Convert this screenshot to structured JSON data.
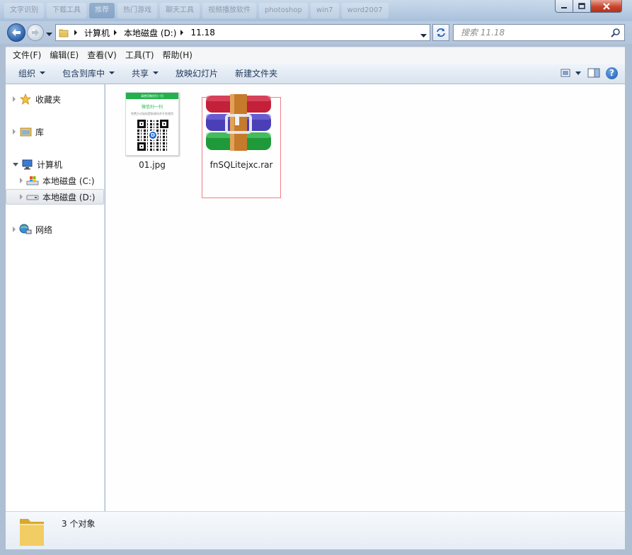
{
  "titlebar": {
    "ghost_tabs": [
      "文字识别",
      "下载工具",
      "推荐",
      "热门游戏",
      "聊天工具",
      "视频播放软件",
      "photoshop",
      "win7",
      "word2007"
    ]
  },
  "address": {
    "breadcrumbs": [
      "计算机",
      "本地磁盘 (D:)",
      "11.18"
    ]
  },
  "search": {
    "placeholder": "搜索 11.18"
  },
  "menu": {
    "items": [
      "文件(F)",
      "编辑(E)",
      "查看(V)",
      "工具(T)",
      "帮助(H)"
    ]
  },
  "toolbar": {
    "organize": "组织",
    "include_in_library": "包含到库中",
    "share": "共享",
    "slideshow": "放映幻灯片",
    "new_folder": "新建文件夹"
  },
  "nav": {
    "favorites": "收藏夹",
    "libraries": "库",
    "computer": "计算机",
    "drive_c": "本地磁盘 (C:)",
    "drive_d": "本地磁盘 (D:)",
    "network": "网络"
  },
  "files": [
    {
      "name": "01.jpg",
      "icon": "jpg-thumbnail",
      "thumb_header": "请使用微信扫一扫",
      "thumb_title": "微信扫一扫",
      "thumb_sub": "免费方式轻松提取源码并开发使用"
    },
    {
      "name": "fnSQLitejxc.rar",
      "icon": "winrar-archive-icon"
    }
  ],
  "status": {
    "count_text": "3 个对象"
  },
  "colors": {
    "selection_border": "#f07f86",
    "window_frame": "#aebfd4",
    "toolbar_text": "#1e395b"
  }
}
